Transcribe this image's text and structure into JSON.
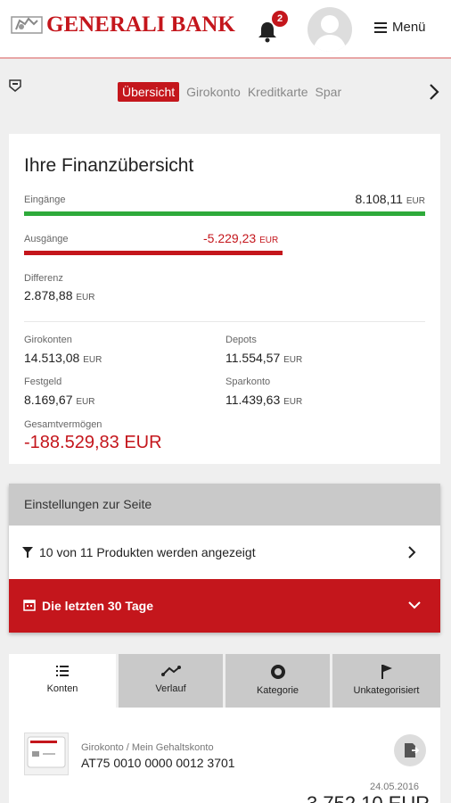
{
  "header": {
    "brand": "GENERALI BANK",
    "notification_count": "2",
    "menu_label": "Menü"
  },
  "tabs": [
    {
      "label": "Übersicht",
      "active": true
    },
    {
      "label": "Girokonto",
      "active": false
    },
    {
      "label": "Kreditkarte",
      "active": false
    },
    {
      "label": "Spar",
      "active": false
    }
  ],
  "overview": {
    "title": "Ihre Finanzübersicht",
    "income_label": "Eingänge",
    "income_value": "8.108,11",
    "expense_label": "Ausgänge",
    "expense_value": "-5.229,23",
    "currency": "EUR",
    "diff_label": "Differenz",
    "diff_value": "2.878,88",
    "giro_label": "Girokonten",
    "giro_value": "14.513,08",
    "depot_label": "Depots",
    "depot_value": "11.554,57",
    "fest_label": "Festgeld",
    "fest_value": "8.169,67",
    "spar_label": "Sparkonto",
    "spar_value": "11.439,63",
    "total_label": "Gesamtvermögen",
    "total_value": "-188.529,83 EUR",
    "expense_ratio": 0.645
  },
  "settings": {
    "title": "Einstellungen zur Seite",
    "products_text": "10 von 11 Produkten werden angezeigt",
    "range_text": "Die letzten 30 Tage"
  },
  "bottom_tabs": [
    {
      "label": "Konten",
      "icon": "list-icon",
      "active": true
    },
    {
      "label": "Verlauf",
      "icon": "trend-icon",
      "active": false
    },
    {
      "label": "Kategorie",
      "icon": "donut-icon",
      "active": false
    },
    {
      "label": "Unkategorisiert",
      "icon": "flag-icon",
      "active": false
    }
  ],
  "account": {
    "type": "Girokonto / Mein Gehaltskonto",
    "iban": "AT75 0010 0000 0012 3701",
    "date": "24.05.2016",
    "balance": "3.752,10 EUR"
  },
  "colors": {
    "brand_red": "#c4161c",
    "income_green": "#2eaa3a",
    "settings_grey": "#c9c9c9"
  }
}
